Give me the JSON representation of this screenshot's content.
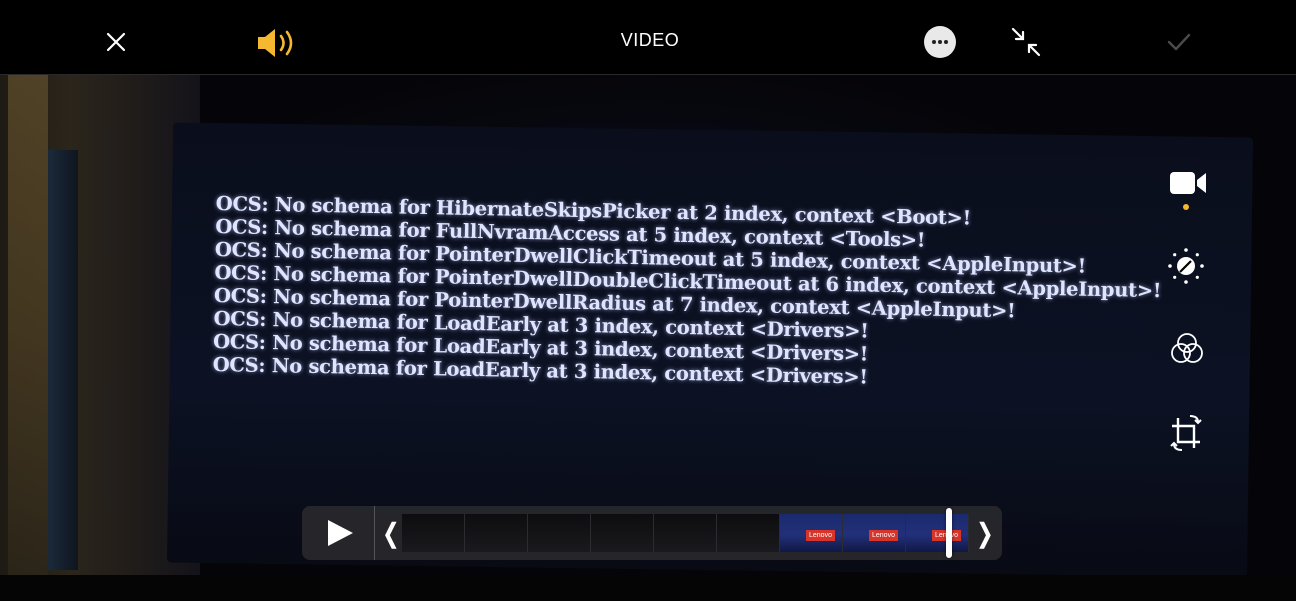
{
  "topbar": {
    "title": "VIDEO",
    "close_icon": "close-icon",
    "sound_icon": "speaker-on-icon",
    "more_icon": "more-ellipsis-icon",
    "shrink_icon": "minimize-arrows-icon",
    "done_icon": "checkmark-icon"
  },
  "colors": {
    "accent": "#f5b82e",
    "background": "#000000",
    "console_text": "#dfe4ff",
    "timeline_bg": "#28282c"
  },
  "console": {
    "lines": [
      "OCS: No schema for HibernateSkipsPicker at 2 index, context <Boot>!",
      "OCS: No schema for FullNvramAccess at 5 index, context <Tools>!",
      "OCS: No schema for PointerDwellClickTimeout at 5 index, context <AppleInput>!",
      "OCS: No schema for PointerDwellDoubleClickTimeout at 6 index, context <AppleInput>!",
      "OCS: No schema for PointerDwellRadius at 7 index, context <AppleInput>!",
      "OCS: No schema for LoadEarly at 3 index, context <Drivers>!",
      "OCS: No schema for LoadEarly at 3 index, context <Drivers>!",
      "OCS: No schema for LoadEarly at 3 index, context <Drivers>!"
    ]
  },
  "tools": [
    {
      "name": "video-icon",
      "selected": true
    },
    {
      "name": "adjust-dial-icon",
      "selected": false
    },
    {
      "name": "filters-icon",
      "selected": false
    },
    {
      "name": "crop-rotate-icon",
      "selected": false
    }
  ],
  "timeline": {
    "play_icon": "play-icon",
    "thumbnails": [
      {
        "type": "dark",
        "logo": ""
      },
      {
        "type": "dark",
        "logo": ""
      },
      {
        "type": "dark",
        "logo": ""
      },
      {
        "type": "dark",
        "logo": ""
      },
      {
        "type": "dark",
        "logo": ""
      },
      {
        "type": "dark",
        "logo": ""
      },
      {
        "type": "lenovo",
        "logo": "Lenovo"
      },
      {
        "type": "lenovo",
        "logo": "Lenovo"
      },
      {
        "type": "lenovo",
        "logo": "Lenovo"
      }
    ],
    "playhead_position": 0.96
  }
}
